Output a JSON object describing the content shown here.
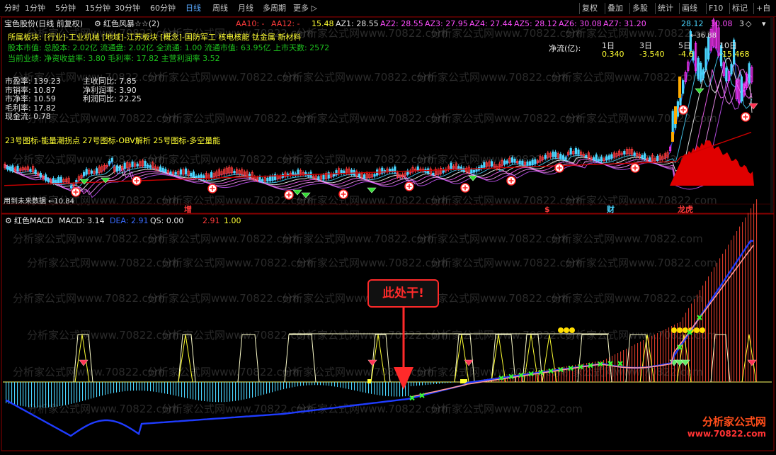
{
  "toolbar": {
    "periods": [
      "分时",
      "1分钟",
      "5分钟",
      "15分钟",
      "30分钟",
      "60分钟",
      "日线",
      "周线",
      "月线",
      "多周期",
      "更多"
    ],
    "active_period": "日线",
    "right_buttons": [
      "复权",
      "叠加",
      "多股",
      "统计",
      "画线",
      "F10",
      "标记",
      "+自"
    ]
  },
  "header": {
    "stock_title": "宝色股份(日线 前复权)",
    "indicator_name": "红色风暴☆☆(2)",
    "az_values": [
      "AA10: -",
      "AA12: -",
      "15.48",
      "AZ1: 28.55",
      "AZ2: 28.55",
      "AZ3: 27.95",
      "AZ4: 27.44",
      "AZ5: 28.12",
      "AZ6: 30.08",
      "AZ7: 31.20"
    ],
    "right_values": [
      "28.12",
      "30.08",
      "3"
    ]
  },
  "info": {
    "sector": "所属板块: [行业]-工业机械 [地域]-江苏板块 [概念]-国防军工 核电核能 钛金属 新材料",
    "capital": "股本市值: 总股本: 2.02亿 流通盘: 2.02亿 全流通: 1.00 流通市值: 63.95亿 上市天数: 2572",
    "performance": "当前业绩: 净资收益率: 3.80 毛利率: 17.82 主营利润率 3.52",
    "ratios_left": [
      "市盈率: 139.23",
      "市销率: 10.87",
      "市净率: 10.59",
      "毛利率: 17.82",
      "现金流: 0.78"
    ],
    "ratios_right": [
      "主收同比: 7.85",
      "净利润率: 3.90",
      "利润同比: 22.25"
    ],
    "formula_line": "23号图标-能量潮拐点 27号图标-OBV解析 25号图标-多空量能",
    "future_data_label": "用到未来数据",
    "low_price_label": "←10.84",
    "high_price_label": "←36.88"
  },
  "netflow": {
    "label": "净流(亿):",
    "periods": [
      "1日",
      "3日",
      "5日",
      "10日"
    ],
    "values": [
      "0.340",
      "-3.540",
      "-4.6",
      "-15.468"
    ]
  },
  "event_markers": [
    "增",
    "$",
    "财",
    "龙虎"
  ],
  "macd_panel": {
    "name": "红色MACD",
    "macd": "MACD: 3.14",
    "dea": "DEA: 2.91",
    "qs": "QS: 0.00",
    "v1": "2.91",
    "v2": "1.00"
  },
  "callout_text": "此处干!",
  "watermark": "分析家公式网www.70822.com",
  "brand_name": "分析家公式网",
  "brand_url": "www.70822.com",
  "colors": {
    "up": "#ff3b3b",
    "down": "#4ad6ff",
    "macd_line": "#1f3cff",
    "dea_line": "#ff9a9a",
    "hist_up": "#d83a2a",
    "hist_down": "#4ad6ff",
    "border": "#8b0000"
  }
}
